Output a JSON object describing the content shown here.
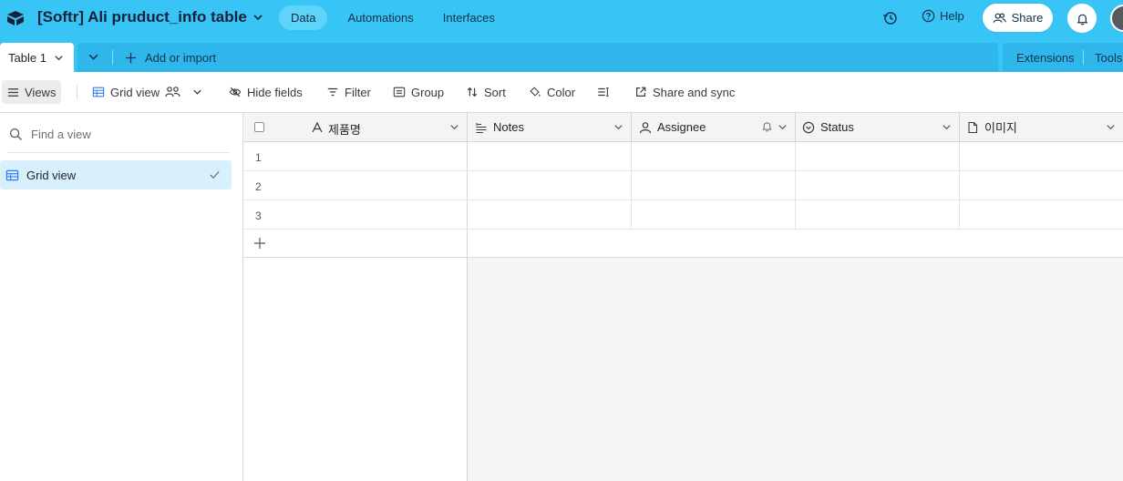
{
  "app": {
    "base_title": "[Softr] Ali pruduct_info table",
    "nav": [
      {
        "label": "Data",
        "active": true
      },
      {
        "label": "Automations",
        "active": false
      },
      {
        "label": "Interfaces",
        "active": false
      }
    ],
    "help_label": "Help",
    "share_label": "Share",
    "accent_color": "#39c4f6"
  },
  "tabs": {
    "active_table": "Table 1",
    "add_import_label": "Add or import",
    "extensions_label": "Extensions",
    "tools_label": "Tools"
  },
  "viewbar": {
    "views_label": "Views",
    "current_view": "Grid view",
    "hide_fields": "Hide fields",
    "filter": "Filter",
    "group": "Group",
    "sort": "Sort",
    "color": "Color",
    "share_sync": "Share and sync"
  },
  "sidebar": {
    "find_placeholder": "Find a view",
    "views": [
      {
        "label": "Grid view",
        "selected": true
      }
    ]
  },
  "grid": {
    "columns": [
      {
        "label": "제품명",
        "icon": "text-icon"
      },
      {
        "label": "Notes",
        "icon": "long-text-icon"
      },
      {
        "label": "Assignee",
        "icon": "user-icon"
      },
      {
        "label": "Status",
        "icon": "status-icon"
      },
      {
        "label": "이미지",
        "icon": "file-icon"
      }
    ],
    "rows": [
      {
        "num": "1"
      },
      {
        "num": "2"
      },
      {
        "num": "3"
      }
    ]
  }
}
